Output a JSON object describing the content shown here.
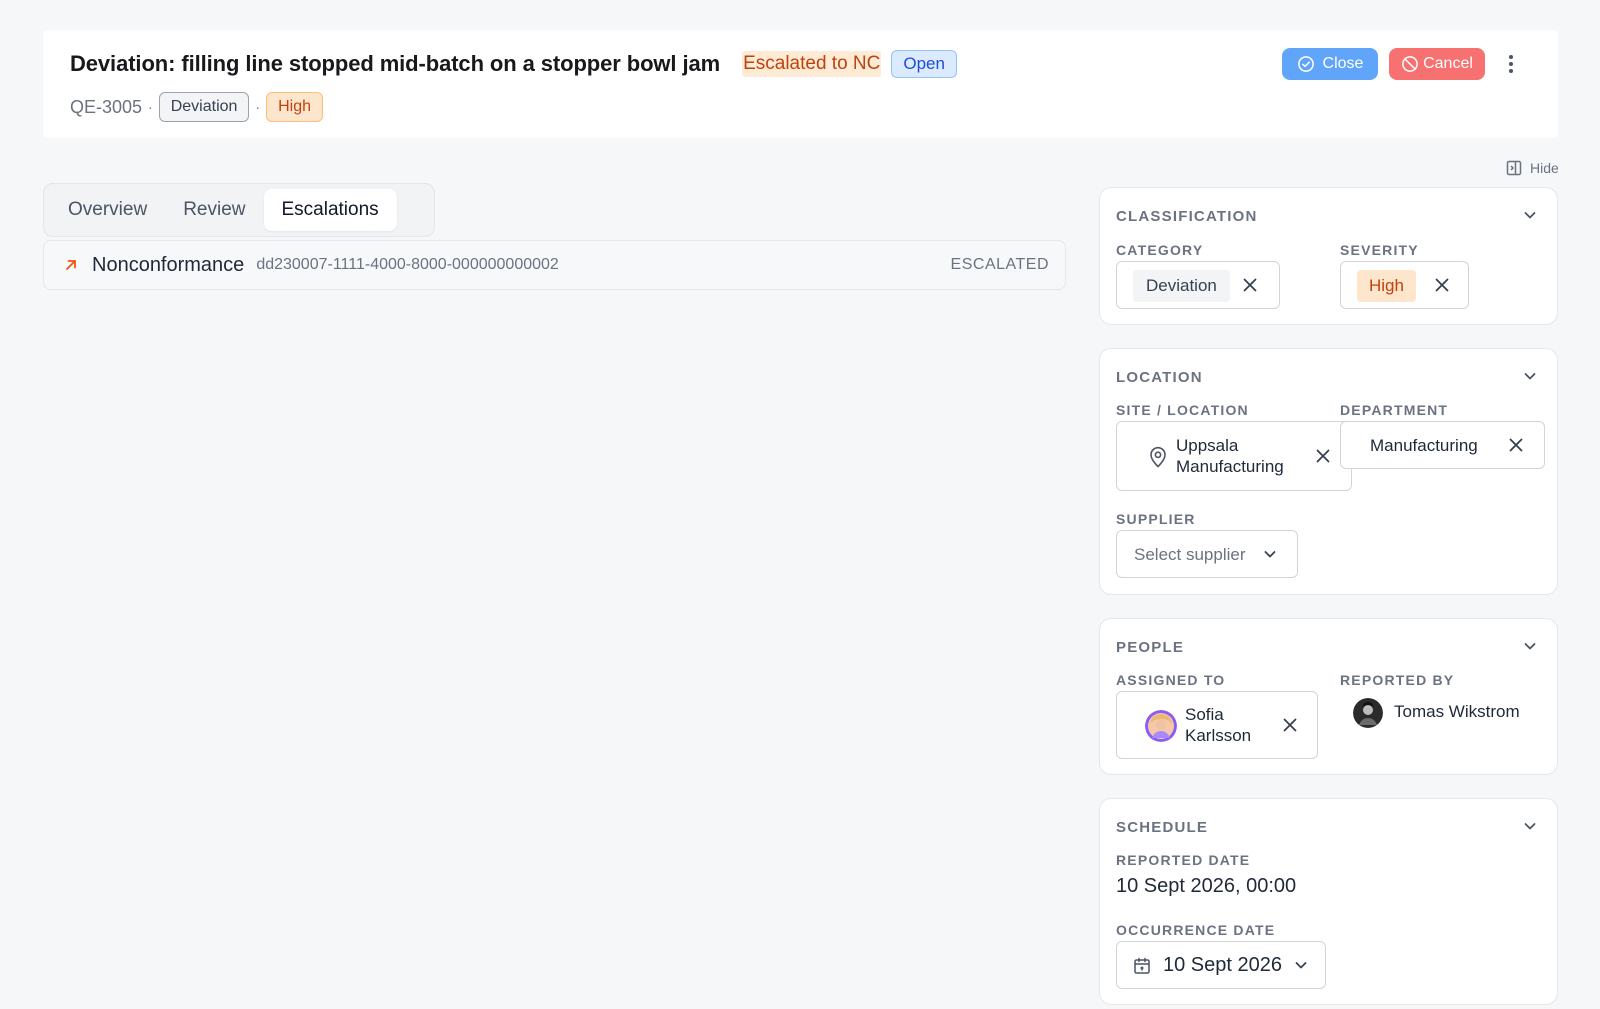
{
  "header": {
    "title": "Deviation: filling line stopped mid-batch on a stopper bowl jam",
    "status_escalated": "Escalated to NC",
    "status_open": "Open",
    "record_id": "QE-3005",
    "separator": "·",
    "category_tag": "Deviation",
    "severity_tag": "High",
    "close_label": "Close",
    "cancel_label": "Cancel"
  },
  "panel_toggle": {
    "label": "Hide"
  },
  "tabs": [
    {
      "label": "Overview"
    },
    {
      "label": "Review"
    },
    {
      "label": "Escalations",
      "active": true
    }
  ],
  "escalations": [
    {
      "type": "Nonconformance",
      "id": "dd230007-1111-4000-8000-000000000002",
      "status": "ESCALATED"
    }
  ],
  "classification": {
    "title": "CLASSIFICATION",
    "category_label": "CATEGORY",
    "category_value": "Deviation",
    "severity_label": "SEVERITY",
    "severity_value": "High"
  },
  "location": {
    "title": "LOCATION",
    "site_label": "SITE / LOCATION",
    "site_value_line1": "Uppsala",
    "site_value_line2": "Manufacturing",
    "department_label": "DEPARTMENT",
    "department_value": "Manufacturing",
    "supplier_label": "SUPPLIER",
    "supplier_placeholder": "Select supplier"
  },
  "people": {
    "title": "PEOPLE",
    "assigned_label": "ASSIGNED TO",
    "assigned_first": "Sofia",
    "assigned_last": "Karlsson",
    "reported_label": "REPORTED BY",
    "reported_name": "Tomas Wikstrom"
  },
  "schedule": {
    "title": "SCHEDULE",
    "reported_date_label": "REPORTED DATE",
    "reported_date_value": "10 Sept 2026, 00:00",
    "occurrence_date_label": "OCCURRENCE DATE",
    "occurrence_date_value": "10 Sept 2026"
  },
  "colors": {
    "accent_blue": "#60a5fa",
    "danger_red": "#f87171",
    "warning_orange": "#c2410c"
  },
  "icons": {
    "close": "check-circle-icon",
    "cancel": "ban-icon",
    "more": "more-vertical-icon",
    "hide": "panel-right-icon",
    "escalation": "arrow-up-right-icon",
    "remove": "x-icon",
    "location": "map-pin-icon",
    "collapse": "chevron-down-icon",
    "date": "calendar-icon"
  }
}
